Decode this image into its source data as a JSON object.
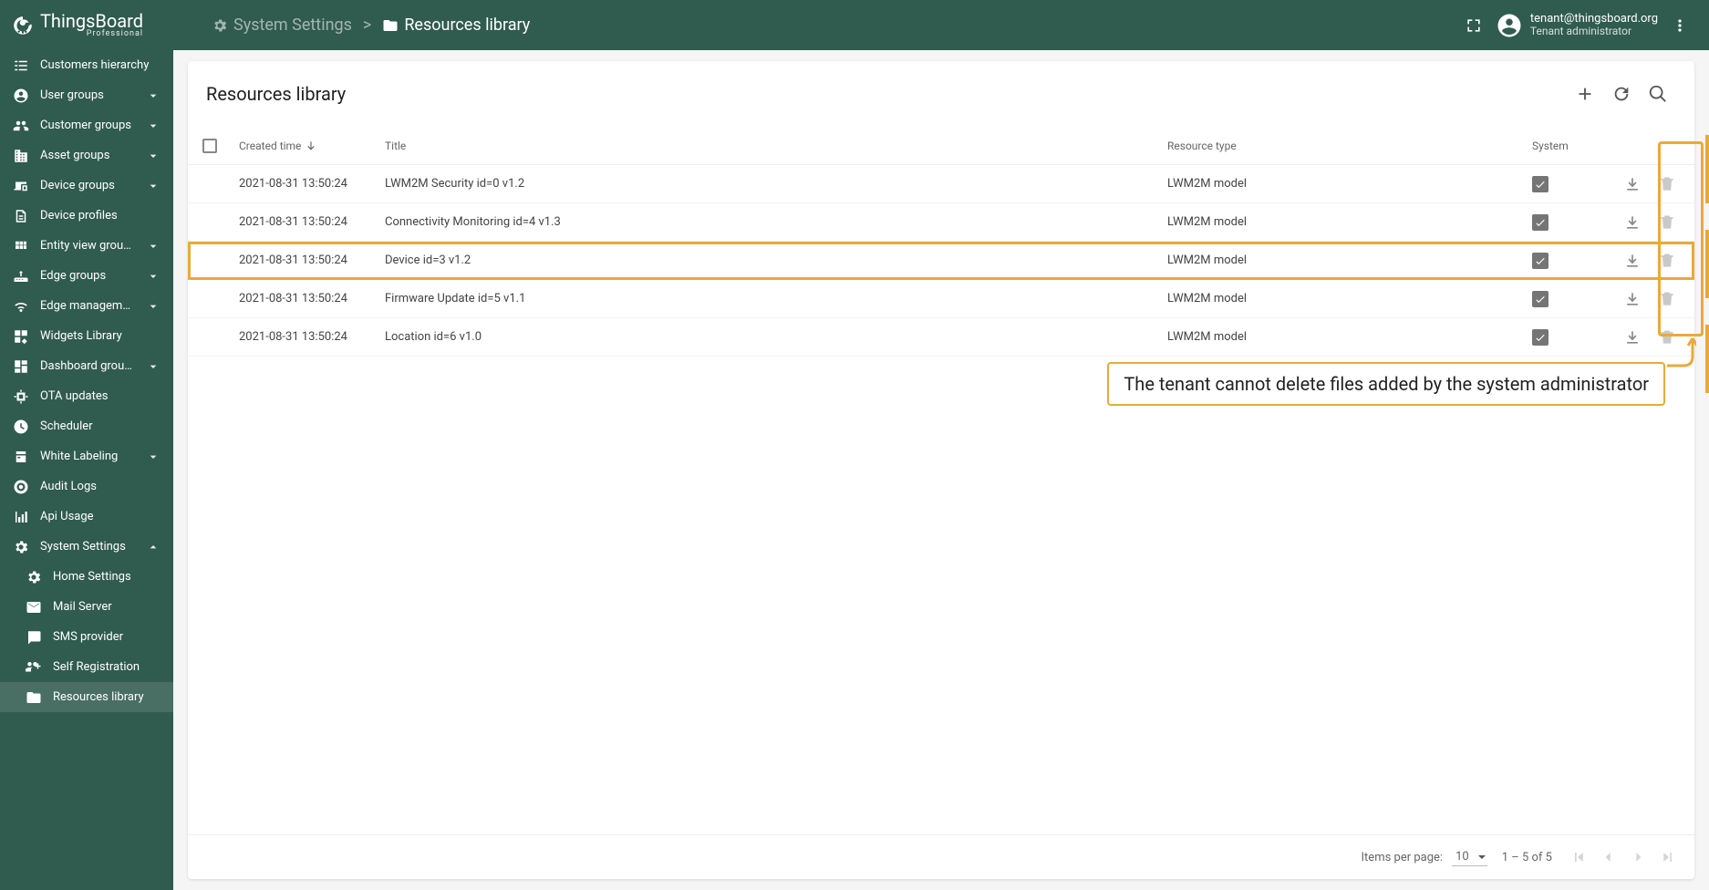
{
  "brand": {
    "name": "ThingsBoard",
    "edition": "Professional"
  },
  "breadcrumb": {
    "parent": "System Settings",
    "current": "Resources library"
  },
  "user": {
    "email": "tenant@thingsboard.org",
    "role": "Tenant administrator"
  },
  "sidebar": [
    {
      "icon": "hierarchy",
      "label": "Customers hierarchy",
      "expand": null,
      "sub": false,
      "active": false
    },
    {
      "icon": "account",
      "label": "User groups",
      "expand": "down",
      "sub": false,
      "active": false
    },
    {
      "icon": "supervisor",
      "label": "Customer groups",
      "expand": "down",
      "sub": false,
      "active": false
    },
    {
      "icon": "domain",
      "label": "Asset groups",
      "expand": "down",
      "sub": false,
      "active": false
    },
    {
      "icon": "devices",
      "label": "Device groups",
      "expand": "down",
      "sub": false,
      "active": false
    },
    {
      "icon": "profile",
      "label": "Device profiles",
      "expand": null,
      "sub": false,
      "active": false
    },
    {
      "icon": "viewmodule",
      "label": "Entity view groups",
      "expand": "down",
      "sub": false,
      "active": false
    },
    {
      "icon": "router",
      "label": "Edge groups",
      "expand": "down",
      "sub": false,
      "active": false
    },
    {
      "icon": "wifi",
      "label": "Edge management",
      "expand": "down",
      "sub": false,
      "active": false
    },
    {
      "icon": "widgets",
      "label": "Widgets Library",
      "expand": null,
      "sub": false,
      "active": false
    },
    {
      "icon": "dashboard",
      "label": "Dashboard groups",
      "expand": "down",
      "sub": false,
      "active": false
    },
    {
      "icon": "memory",
      "label": "OTA updates",
      "expand": null,
      "sub": false,
      "active": false
    },
    {
      "icon": "schedule",
      "label": "Scheduler",
      "expand": null,
      "sub": false,
      "active": false
    },
    {
      "icon": "format",
      "label": "White Labeling",
      "expand": "down",
      "sub": false,
      "active": false
    },
    {
      "icon": "track",
      "label": "Audit Logs",
      "expand": null,
      "sub": false,
      "active": false
    },
    {
      "icon": "chart",
      "label": "Api Usage",
      "expand": null,
      "sub": false,
      "active": false
    },
    {
      "icon": "settings",
      "label": "System Settings",
      "expand": "up",
      "sub": false,
      "active": false
    },
    {
      "icon": "settings",
      "label": "Home Settings",
      "expand": null,
      "sub": true,
      "active": false
    },
    {
      "icon": "mail",
      "label": "Mail Server",
      "expand": null,
      "sub": true,
      "active": false
    },
    {
      "icon": "sms",
      "label": "SMS provider",
      "expand": null,
      "sub": true,
      "active": false
    },
    {
      "icon": "groupadd",
      "label": "Self Registration",
      "expand": null,
      "sub": true,
      "active": false
    },
    {
      "icon": "folder",
      "label": "Resources library",
      "expand": null,
      "sub": true,
      "active": true
    }
  ],
  "table": {
    "title": "Resources library",
    "columns": {
      "created": "Created time",
      "title": "Title",
      "type": "Resource type",
      "system": "System"
    },
    "rows": [
      {
        "created": "2021-08-31 13:50:24",
        "title": "LWM2M Security id=0 v1.2",
        "type": "LWM2M model",
        "system": true,
        "highlight": false
      },
      {
        "created": "2021-08-31 13:50:24",
        "title": "Connectivity Monitoring id=4 v1.3",
        "type": "LWM2M model",
        "system": true,
        "highlight": false
      },
      {
        "created": "2021-08-31 13:50:24",
        "title": "Device id=3 v1.2",
        "type": "LWM2M model",
        "system": true,
        "highlight": true
      },
      {
        "created": "2021-08-31 13:50:24",
        "title": "Firmware Update id=5 v1.1",
        "type": "LWM2M model",
        "system": true,
        "highlight": false
      },
      {
        "created": "2021-08-31 13:50:24",
        "title": "Location id=6 v1.0",
        "type": "LWM2M model",
        "system": true,
        "highlight": false
      }
    ]
  },
  "callout": "The tenant cannot delete files added by the system administrator",
  "pagination": {
    "label": "Items per page:",
    "perPage": "10",
    "range": "1 – 5 of 5"
  }
}
